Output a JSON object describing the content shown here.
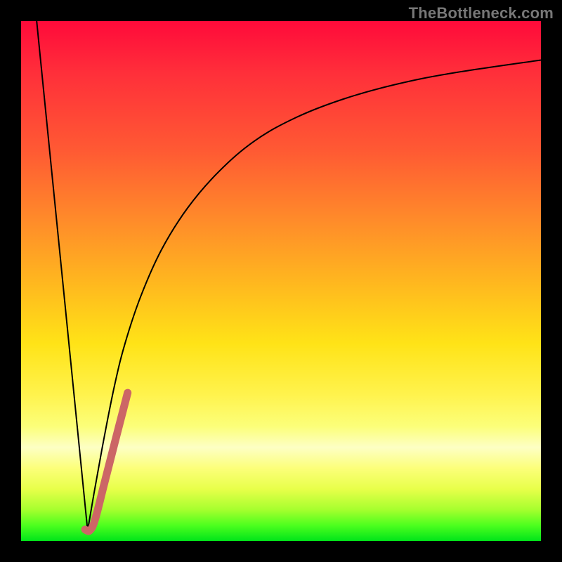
{
  "watermark": "TheBottleneck.com",
  "chart_data": {
    "type": "line",
    "title": "",
    "xlabel": "",
    "ylabel": "",
    "xlim": [
      0,
      100
    ],
    "ylim": [
      0,
      100
    ],
    "grid": false,
    "series": [
      {
        "name": "curve-descent",
        "color": "#000000",
        "width": 2,
        "x": [
          3,
          12.8
        ],
        "values": [
          100,
          2
        ]
      },
      {
        "name": "curve-log-rise",
        "color": "#000000",
        "width": 2,
        "x": [
          12.8,
          14,
          16,
          18,
          20,
          23,
          27,
          32,
          38,
          45,
          53,
          62,
          72,
          83,
          100
        ],
        "values": [
          2,
          9,
          20,
          30,
          38,
          47,
          56,
          64,
          71,
          77,
          81.5,
          85,
          87.8,
          90,
          92.5
        ]
      },
      {
        "name": "highlight-hook",
        "color": "#cc6666",
        "width": 11,
        "linecap": "round",
        "x": [
          12.3,
          13.2,
          14.2,
          16.0,
          18.3,
          20.5
        ],
        "values": [
          2.2,
          2.0,
          4.0,
          11.0,
          20.0,
          28.5
        ]
      }
    ]
  }
}
